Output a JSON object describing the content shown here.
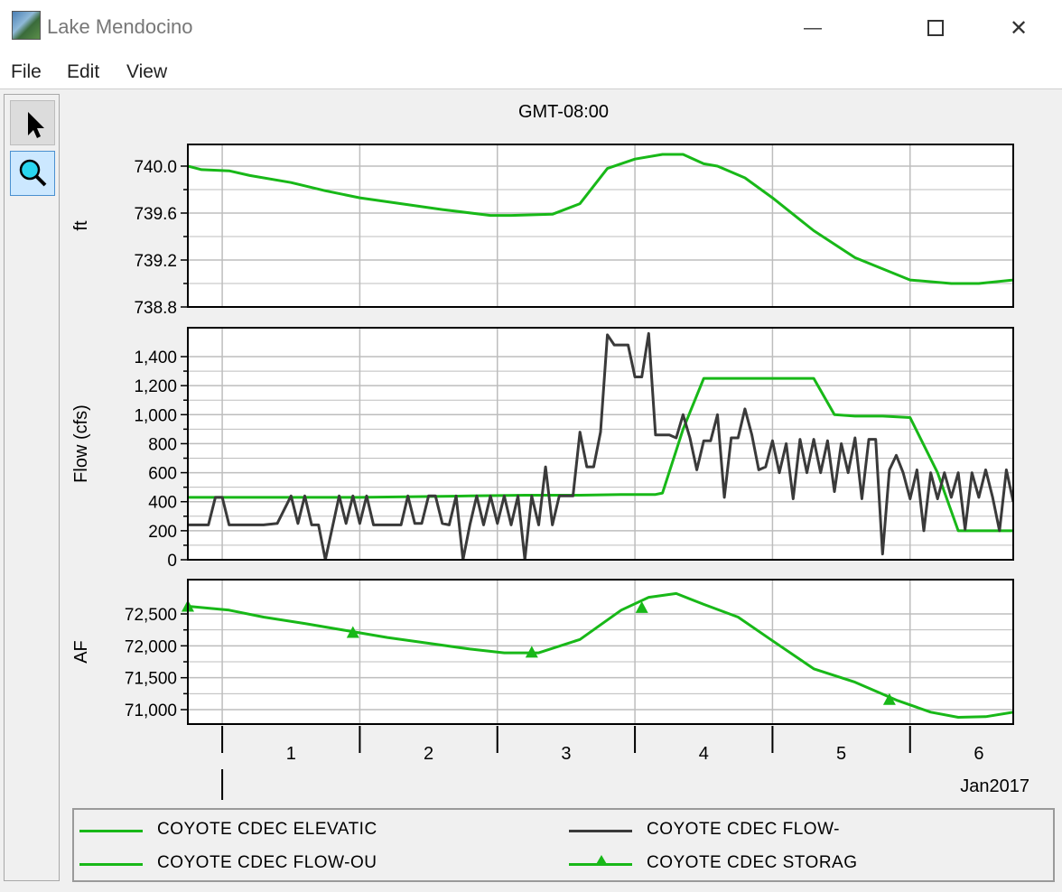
{
  "window": {
    "title": "Lake Mendocino",
    "minimize_glyph": "—",
    "maximize_glyph": "☐",
    "close_glyph": "✕"
  },
  "menu": [
    "File",
    "Edit",
    "View"
  ],
  "toolbar": {
    "pointer_icon": "pointer-arrow-icon",
    "zoom_icon": "magnifier-icon"
  },
  "colors": {
    "green": "#18b818",
    "gray": "#3a3a3a",
    "grid": "#bdbdbd"
  },
  "chart_data": {
    "type": "line",
    "timezone_label": "GMT-08:00",
    "x_axis": {
      "unit": "days",
      "day_labels": [
        "1",
        "2",
        "3",
        "4",
        "5",
        "6"
      ],
      "month_label": "Jan2017",
      "range": [
        -0.25,
        5.75
      ]
    },
    "panels": [
      {
        "ylabel": "ft",
        "ylim": [
          738.8,
          740.2
        ],
        "yticks": [
          740.0,
          739.6,
          739.2,
          738.8
        ],
        "ytick_labels": [
          "740.0",
          "739.6",
          "739.2",
          "738.8"
        ],
        "series": [
          {
            "name": "COYOTE CDEC ELEVATIC",
            "color": "#18b818",
            "x": [
              -0.25,
              -0.15,
              0.05,
              0.2,
              0.5,
              0.75,
              1.0,
              1.3,
              1.6,
              1.95,
              2.1,
              2.4,
              2.6,
              2.8,
              3.0,
              3.2,
              3.35,
              3.5,
              3.6,
              3.8,
              4.0,
              4.3,
              4.6,
              5.0,
              5.3,
              5.5,
              5.75
            ],
            "y": [
              740.0,
              739.97,
              739.96,
              739.92,
              739.86,
              739.79,
              739.73,
              739.68,
              739.63,
              739.58,
              739.58,
              739.59,
              739.68,
              739.98,
              740.06,
              740.1,
              740.1,
              740.02,
              740.0,
              739.9,
              739.73,
              739.45,
              739.22,
              739.03,
              739.0,
              739.0,
              739.03
            ]
          }
        ]
      },
      {
        "ylabel": "Flow (cfs)",
        "ylim": [
          0,
          1600
        ],
        "yticks": [
          1400,
          1200,
          1000,
          800,
          600,
          400,
          200,
          0
        ],
        "ytick_labels": [
          "1,400",
          "1,200",
          "1,000",
          "800",
          "600",
          "400",
          "200",
          "0"
        ],
        "series": [
          {
            "name": "COYOTE CDEC FLOW-OU",
            "color": "#18b818",
            "x": [
              -0.25,
              0.2,
              0.6,
              1.0,
              1.4,
              1.8,
              2.2,
              2.6,
              2.9,
              3.15,
              3.2,
              3.35,
              3.5,
              3.75,
              4.1,
              4.3,
              4.45,
              4.6,
              4.8,
              5.0,
              5.2,
              5.35,
              5.5,
              5.75
            ],
            "y": [
              430,
              430,
              430,
              430,
              435,
              440,
              445,
              445,
              450,
              450,
              460,
              900,
              1250,
              1250,
              1250,
              1250,
              1000,
              990,
              990,
              980,
              600,
              200,
              200,
              200
            ]
          },
          {
            "name": "COYOTE CDEC FLOW-",
            "color": "#3a3a3a",
            "x": [
              -0.25,
              -0.1,
              -0.05,
              0.0,
              0.05,
              0.1,
              0.2,
              0.3,
              0.4,
              0.5,
              0.55,
              0.6,
              0.65,
              0.7,
              0.75,
              0.85,
              0.9,
              0.95,
              1.0,
              1.05,
              1.1,
              1.15,
              1.2,
              1.3,
              1.35,
              1.4,
              1.45,
              1.5,
              1.55,
              1.6,
              1.65,
              1.7,
              1.75,
              1.8,
              1.85,
              1.9,
              1.95,
              2.0,
              2.05,
              2.1,
              2.15,
              2.2,
              2.25,
              2.3,
              2.35,
              2.4,
              2.45,
              2.5,
              2.55,
              2.6,
              2.65,
              2.7,
              2.75,
              2.8,
              2.85,
              2.95,
              3.0,
              3.05,
              3.1,
              3.15,
              3.2,
              3.25,
              3.3,
              3.35,
              3.4,
              3.45,
              3.5,
              3.55,
              3.6,
              3.65,
              3.7,
              3.75,
              3.8,
              3.85,
              3.9,
              3.95,
              4.0,
              4.05,
              4.1,
              4.15,
              4.2,
              4.25,
              4.3,
              4.35,
              4.4,
              4.45,
              4.5,
              4.55,
              4.6,
              4.65,
              4.7,
              4.75,
              4.8,
              4.85,
              4.9,
              4.95,
              5.0,
              5.05,
              5.1,
              5.15,
              5.2,
              5.25,
              5.3,
              5.35,
              5.4,
              5.45,
              5.5,
              5.55,
              5.6,
              5.65,
              5.7,
              5.75
            ],
            "y": [
              240,
              240,
              430,
              430,
              240,
              240,
              240,
              240,
              250,
              440,
              250,
              440,
              240,
              240,
              0,
              440,
              250,
              440,
              250,
              440,
              240,
              240,
              240,
              240,
              440,
              250,
              250,
              440,
              440,
              250,
              240,
              440,
              0,
              240,
              440,
              240,
              440,
              250,
              440,
              240,
              440,
              0,
              440,
              240,
              640,
              240,
              440,
              440,
              440,
              880,
              640,
              640,
              880,
              1550,
              1480,
              1480,
              1260,
              1260,
              1560,
              860,
              860,
              860,
              840,
              1000,
              840,
              620,
              820,
              820,
              1000,
              430,
              840,
              840,
              1040,
              860,
              620,
              640,
              820,
              600,
              800,
              420,
              830,
              600,
              830,
              600,
              820,
              470,
              800,
              600,
              840,
              420,
              830,
              830,
              40,
              620,
              720,
              600,
              420,
              620,
              200,
              600,
              420,
              600,
              430,
              600,
              210,
              600,
              430,
              620,
              430,
              200,
              620,
              400
            ]
          }
        ]
      },
      {
        "ylabel": "AF",
        "ylim": [
          70750,
          72950
        ],
        "yticks": [
          72500,
          72000,
          71500,
          71000
        ],
        "ytick_labels": [
          "72,500",
          "72,000",
          "71,500",
          "71,000"
        ],
        "series": [
          {
            "name": "COYOTE CDEC STORAG",
            "color": "#18b818",
            "marker": "triangle",
            "x": [
              -0.25,
              -0.1,
              0.05,
              0.3,
              0.6,
              0.9,
              1.2,
              1.5,
              1.8,
              2.05,
              2.3,
              2.6,
              2.9,
              3.1,
              3.3,
              3.5,
              3.75,
              4.0,
              4.3,
              4.6,
              4.9,
              5.15,
              5.35,
              5.55,
              5.75
            ],
            "y": [
              72620,
              72590,
              72560,
              72450,
              72350,
              72240,
              72130,
              72040,
              71950,
              71890,
              71890,
              72100,
              72560,
              72760,
              72820,
              72650,
              72450,
              72080,
              71640,
              71430,
              71150,
              70960,
              70880,
              70890,
              70960
            ],
            "marker_x": [
              -0.25,
              0.95,
              2.25,
              3.05,
              4.85
            ],
            "marker_y": [
              72620,
              72210,
              71900,
              72600,
              71160
            ]
          }
        ]
      }
    ],
    "legend": [
      {
        "name": "COYOTE CDEC ELEVATIC",
        "color": "#18b818",
        "marker": "none"
      },
      {
        "name": "COYOTE CDEC FLOW-",
        "color": "#3a3a3a",
        "marker": "none"
      },
      {
        "name": "COYOTE CDEC FLOW-OU",
        "color": "#18b818",
        "marker": "none"
      },
      {
        "name": "COYOTE CDEC STORAG",
        "color": "#18b818",
        "marker": "triangle"
      }
    ]
  }
}
